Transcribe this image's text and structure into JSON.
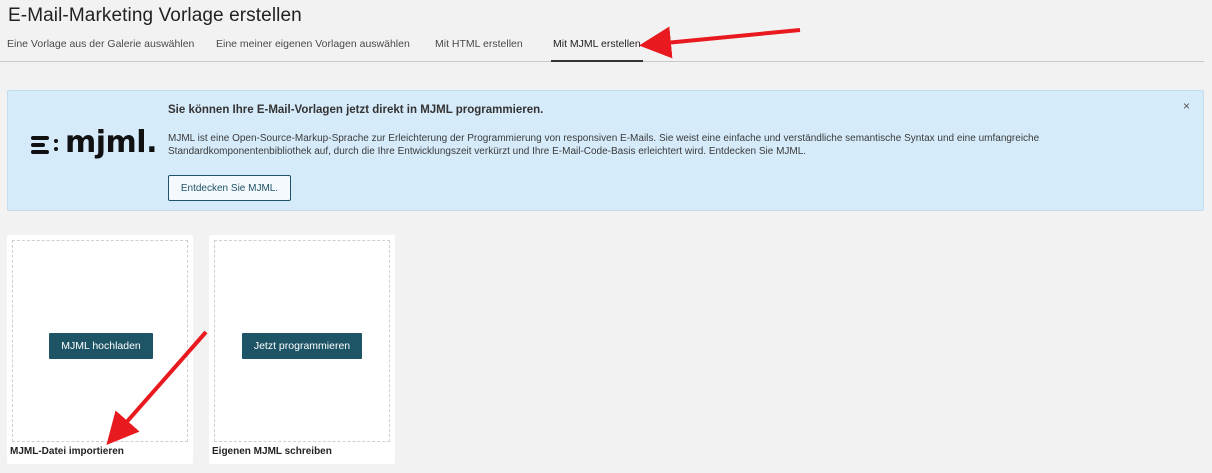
{
  "page": {
    "title": "E-Mail-Marketing Vorlage erstellen"
  },
  "tabs": [
    {
      "label": "Eine Vorlage aus der Galerie auswählen",
      "active": false
    },
    {
      "label": "Eine meiner eigenen Vorlagen auswählen",
      "active": false
    },
    {
      "label": "Mit HTML erstellen",
      "active": false
    },
    {
      "label": "Mit MJML erstellen",
      "active": true
    }
  ],
  "banner": {
    "logo_text": "mjml.",
    "heading": "Sie können Ihre E-Mail-Vorlagen jetzt direkt in MJML programmieren.",
    "text": "MJML ist eine Open-Source-Markup-Sprache zur Erleichterung der Programmierung von responsiven E-Mails. Sie weist eine einfache und verständliche semantische Syntax und eine umfangreiche Standardkomponentenbibliothek auf, durch die Ihre Entwicklungszeit verkürzt und Ihre E-Mail-Code-Basis erleichtert wird. Entdecken Sie MJML.",
    "button_label": "Entdecken Sie MJML.",
    "close_glyph": "×"
  },
  "cards": [
    {
      "button_label": "MJML hochladen",
      "caption": "MJML-Datei importieren"
    },
    {
      "button_label": "Jetzt programmieren",
      "caption": "Eigenen MJML schreiben"
    }
  ],
  "colors": {
    "banner_bg": "#d6ebfa",
    "primary_button": "#1e5566",
    "annotation_arrow": "#e8191f"
  }
}
